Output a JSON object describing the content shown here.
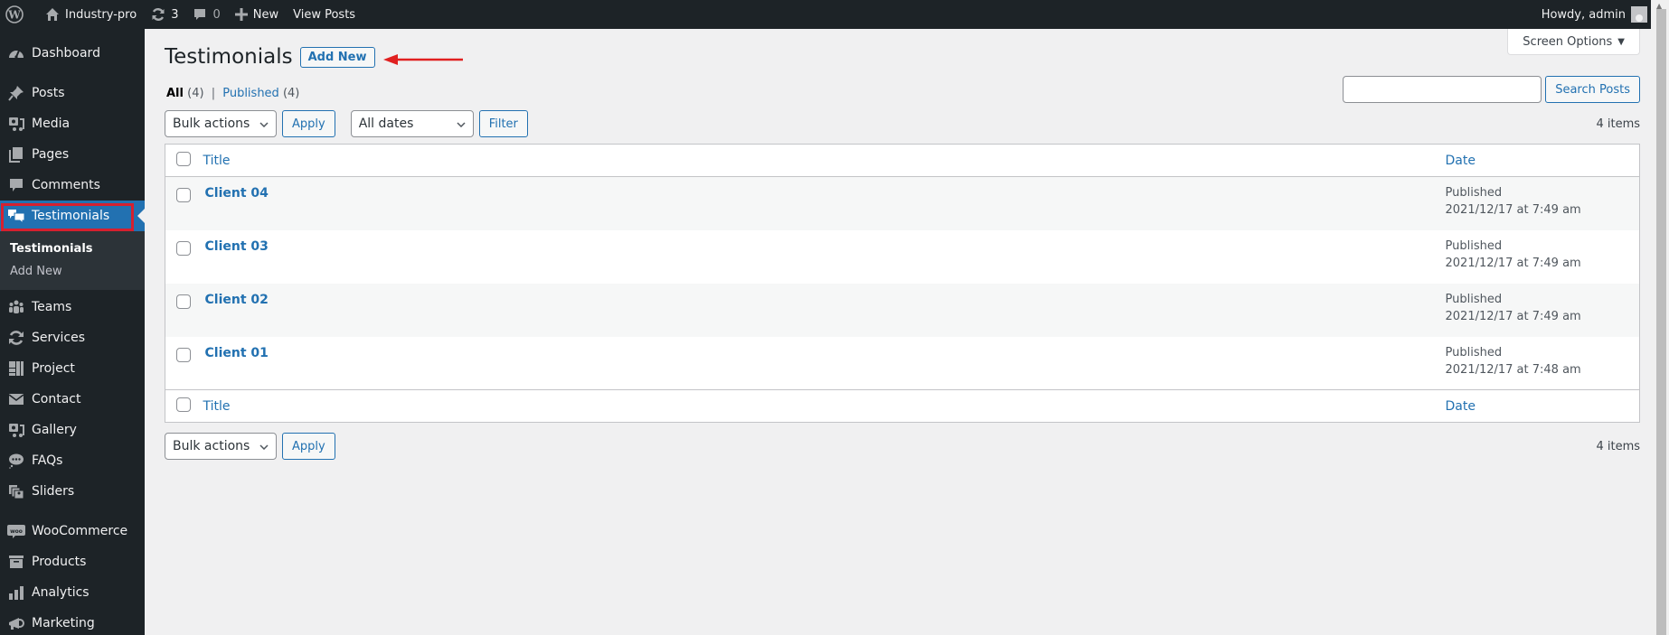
{
  "adminbar": {
    "site_name": "Industry-pro",
    "updates_count": "3",
    "comments_count": "0",
    "new_label": "New",
    "view_posts_label": "View Posts",
    "greeting": "Howdy, admin"
  },
  "sidebar": {
    "items": [
      {
        "label": "Dashboard",
        "icon": "dashboard-icon"
      },
      {
        "label": "Posts",
        "icon": "pin-icon"
      },
      {
        "label": "Media",
        "icon": "media-icon"
      },
      {
        "label": "Pages",
        "icon": "pages-icon"
      },
      {
        "label": "Comments",
        "icon": "comment-icon"
      },
      {
        "label": "Testimonials",
        "icon": "testimonial-icon",
        "active": true
      },
      {
        "label": "Teams",
        "icon": "groups-icon"
      },
      {
        "label": "Services",
        "icon": "update-icon"
      },
      {
        "label": "Project",
        "icon": "portfolio-icon"
      },
      {
        "label": "Contact",
        "icon": "email-icon"
      },
      {
        "label": "Gallery",
        "icon": "media-icon"
      },
      {
        "label": "FAQs",
        "icon": "format-chat-icon"
      },
      {
        "label": "Sliders",
        "icon": "slides-icon"
      },
      {
        "label": "WooCommerce",
        "icon": "woo-icon"
      },
      {
        "label": "Products",
        "icon": "archive-icon"
      },
      {
        "label": "Analytics",
        "icon": "chart-bar-icon"
      },
      {
        "label": "Marketing",
        "icon": "megaphone-icon"
      }
    ],
    "submenu": [
      {
        "label": "Testimonials",
        "current": true
      },
      {
        "label": "Add New",
        "current": false
      }
    ]
  },
  "header": {
    "screen_options": "Screen Options",
    "title": "Testimonials",
    "add_new": "Add New"
  },
  "filters": {
    "all_label": "All",
    "all_count": "(4)",
    "published_label": "Published",
    "published_count": "(4)",
    "separator": "|"
  },
  "search": {
    "value": "",
    "button": "Search Posts"
  },
  "tablenav_top": {
    "bulk_actions": "Bulk actions",
    "apply": "Apply",
    "dates": "All dates",
    "filter": "Filter",
    "items": "4 items"
  },
  "tablenav_bottom": {
    "bulk_actions": "Bulk actions",
    "apply": "Apply",
    "items": "4 items"
  },
  "table": {
    "columns": [
      "Title",
      "Date"
    ],
    "rows": [
      {
        "title": "Client 04",
        "status": "Published",
        "date": "2021/12/17 at 7:49 am"
      },
      {
        "title": "Client 03",
        "status": "Published",
        "date": "2021/12/17 at 7:49 am"
      },
      {
        "title": "Client 02",
        "status": "Published",
        "date": "2021/12/17 at 7:49 am"
      },
      {
        "title": "Client 01",
        "status": "Published",
        "date": "2021/12/17 at 7:48 am"
      }
    ]
  },
  "colors": {
    "accent": "#2271b1",
    "adminbar_bg": "#1d2327",
    "annotation_red": "#d6202f"
  }
}
